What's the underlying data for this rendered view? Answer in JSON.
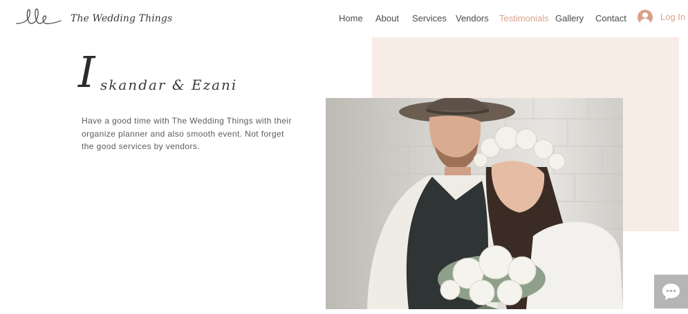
{
  "site": {
    "brand_name": "The Wedding Things",
    "logo_icon": "script-ele-logo"
  },
  "nav": {
    "items": [
      {
        "label": "Home",
        "active": false
      },
      {
        "label": "About",
        "active": false
      },
      {
        "label": "Services",
        "active": false
      },
      {
        "label": "Vendors",
        "active": false
      },
      {
        "label": "Testimonials",
        "active": true
      },
      {
        "label": "Gallery",
        "active": false
      },
      {
        "label": "Contact",
        "active": false
      }
    ],
    "login_label": "Log In",
    "login_icon": "user-avatar-icon"
  },
  "testimonial": {
    "name_initial": "I",
    "name_rest": "skandar & Ezani",
    "text": "Have a good time with The Wedding Things with their organize planner and also smooth event. Not forget the good services by vendors.",
    "photo": "couple-photo"
  },
  "chat_widget": {
    "icon": "chat-bubble-icon"
  },
  "colors": {
    "accent": "#d9a18a",
    "blush_block": "#f8ece6",
    "text": "#2b2b2b",
    "chat_bg": "#b5b5b5"
  }
}
